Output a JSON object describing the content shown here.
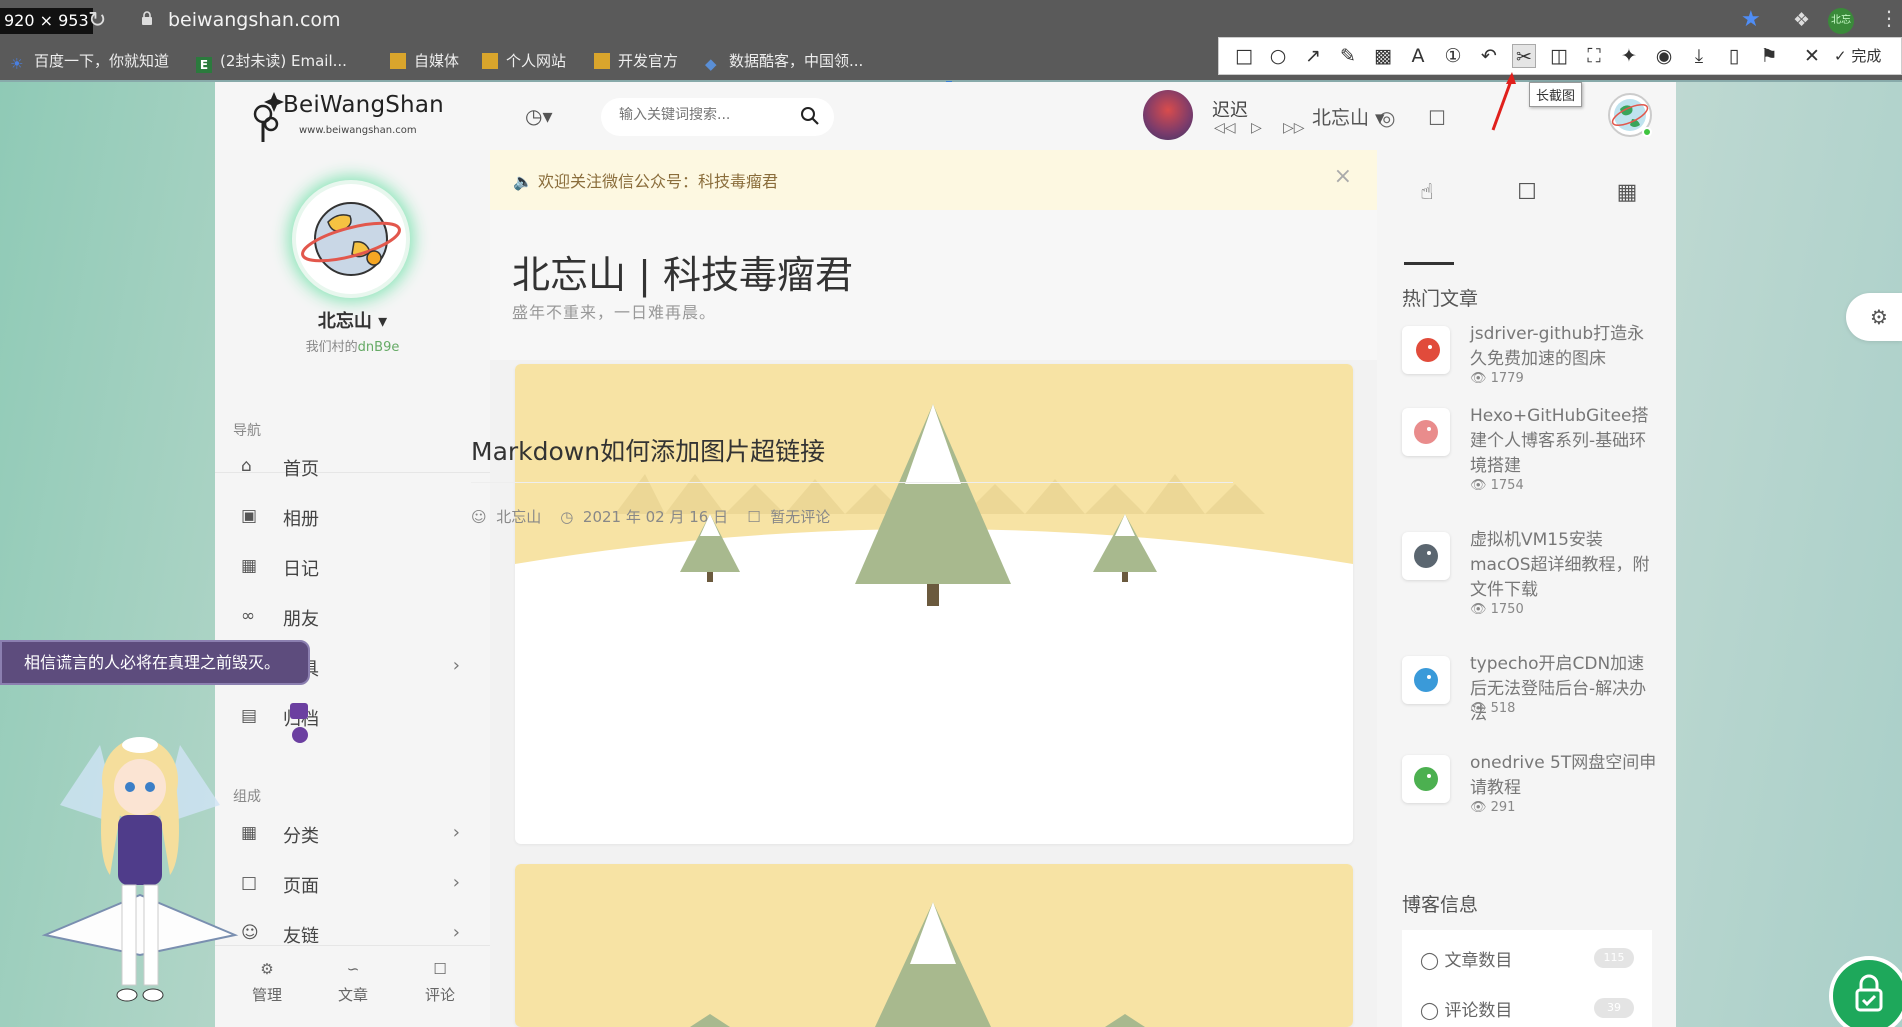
{
  "browser": {
    "resolution_badge": "920 × 953",
    "url": "beiwangshan.com",
    "bookmarks": [
      "百度一下，你就知道",
      "(2封未读) Email...",
      "自媒体",
      "个人网站",
      "开发官方",
      "数据酷客，中国领..."
    ],
    "extension_label": "北忘"
  },
  "screenshot_toolbar": {
    "done_label": "完成",
    "tooltip": "长截图"
  },
  "header": {
    "logo_text": "BeiWangShan",
    "logo_sub": "www.beiwangshan.com",
    "search_placeholder": "输入关键词搜索...",
    "song_title": "迟迟",
    "user_name": "北忘山"
  },
  "sidebar": {
    "profile_name": "北忘山",
    "profile_motto_prefix": "我们村的",
    "profile_motto_suffix": "dnB9e",
    "nav_section": "导航",
    "nav_items": [
      {
        "label": "首页",
        "icon": "home-icon"
      },
      {
        "label": "相册",
        "icon": "image-icon"
      },
      {
        "label": "日记",
        "icon": "calendar-icon"
      },
      {
        "label": "朋友",
        "icon": "link-icon"
      },
      {
        "label": "工具",
        "icon": "tool-icon"
      },
      {
        "label": "归档",
        "icon": "archive-icon"
      }
    ],
    "group_section": "组成",
    "group_items": [
      {
        "label": "分类",
        "icon": "grid-icon"
      },
      {
        "label": "页面",
        "icon": "file-icon"
      },
      {
        "label": "友链",
        "icon": "user-icon"
      }
    ],
    "bottom": [
      "管理",
      "文章",
      "评论"
    ]
  },
  "notice": {
    "text": "欢迎关注微信公众号：科技毒瘤君"
  },
  "banner": {
    "title": "北忘山 | 科技毒瘤君",
    "subtitle": "盛年不重来，一日难再晨。"
  },
  "posts": [
    {
      "title": "Markdown如何添加图片超链接",
      "author": "北忘山",
      "date": "2021 年 02 月 16 日",
      "comments": "暂无评论"
    }
  ],
  "right": {
    "hot_title": "热门文章",
    "hot": [
      {
        "title": "jsdriver-github打造永久免费加速的图床",
        "views": "1779",
        "color": "#e14b3b"
      },
      {
        "title": "Hexo+GitHubGitee搭建个人博客系列-基础环境搭建",
        "views": "1754",
        "color": "#e98c8c"
      },
      {
        "title": "虚拟机VM15安装macOS超详细教程，附文件下载",
        "views": "1750",
        "color": "#5b6670"
      },
      {
        "title": "typecho开启CDN加速后无法登陆后台-解决办法",
        "views": "518",
        "color": "#3a9ad9"
      },
      {
        "title": "onedrive 5T网盘空间申请教程",
        "views": "291",
        "color": "#4cb050"
      }
    ],
    "info_title": "博客信息",
    "info": [
      {
        "label": "文章数目",
        "value": "115"
      },
      {
        "label": "评论数目",
        "value": "39"
      }
    ]
  },
  "waifu": {
    "tip": "相信谎言的人必将在真理之前毁灭。"
  }
}
